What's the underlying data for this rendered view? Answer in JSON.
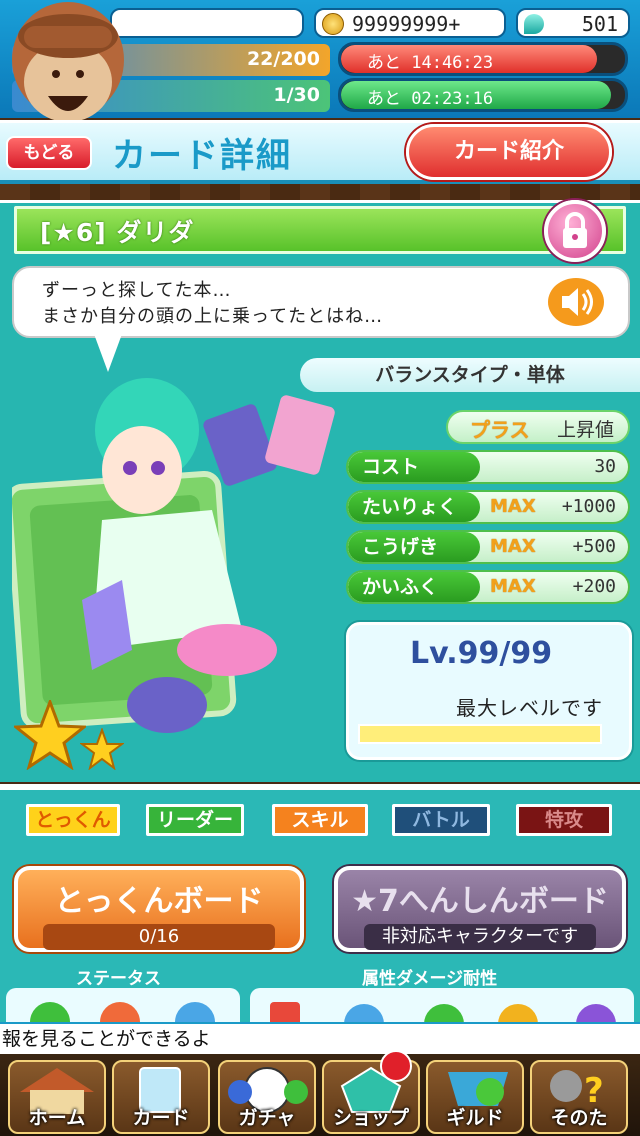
{
  "status": {
    "coins": "99999999+",
    "gems": "501",
    "stamina1": {
      "value": "22/200",
      "timer": "あと 14:46:23",
      "fill": 0.9
    },
    "stamina2": {
      "value": "1/30",
      "timer": "あと 02:23:16",
      "fill": 0.95
    }
  },
  "header": {
    "back_label": "もどる",
    "title": "カード詳細",
    "intro_label": "カード紹介"
  },
  "card": {
    "name": "[★6] ダリダ",
    "quote_line1": "ずーっと探してた本…",
    "quote_line2": "まさか自分の頭の上に乗ってたとはね…",
    "type": "バランスタイプ・単体",
    "plus_label": "プラス",
    "plus_value": "上昇値",
    "stats": [
      {
        "label": "コスト",
        "max": "",
        "value": "30"
      },
      {
        "label": "たいりょく",
        "max": "MAX",
        "value": "+1000"
      },
      {
        "label": "こうげき",
        "max": "MAX",
        "value": "+500"
      },
      {
        "label": "かいふく",
        "max": "MAX",
        "value": "+200"
      }
    ],
    "level": "Lv.99/99",
    "max_level_text": "最大レベルです",
    "rarity_stars": 2
  },
  "tabs": [
    "とっくん",
    "リーダー",
    "スキル",
    "バトル",
    "特攻"
  ],
  "training_board": {
    "title": "とっくんボード",
    "progress": "0/16"
  },
  "transform_board": {
    "title": "★7へんしんボード",
    "note": "非対応キャラクターです"
  },
  "sections": {
    "status": "ステータス",
    "resistance": "属性ダメージ耐性"
  },
  "ticker": "報を見ることができるよ",
  "nav": [
    "ホーム",
    "カード",
    "ガチャ",
    "ショップ",
    "ギルド",
    "そのた"
  ],
  "colors": {
    "accent": "#1a9ac8",
    "panel": "#27b6b0",
    "green": "#49c838",
    "red": "#e02f2f"
  }
}
